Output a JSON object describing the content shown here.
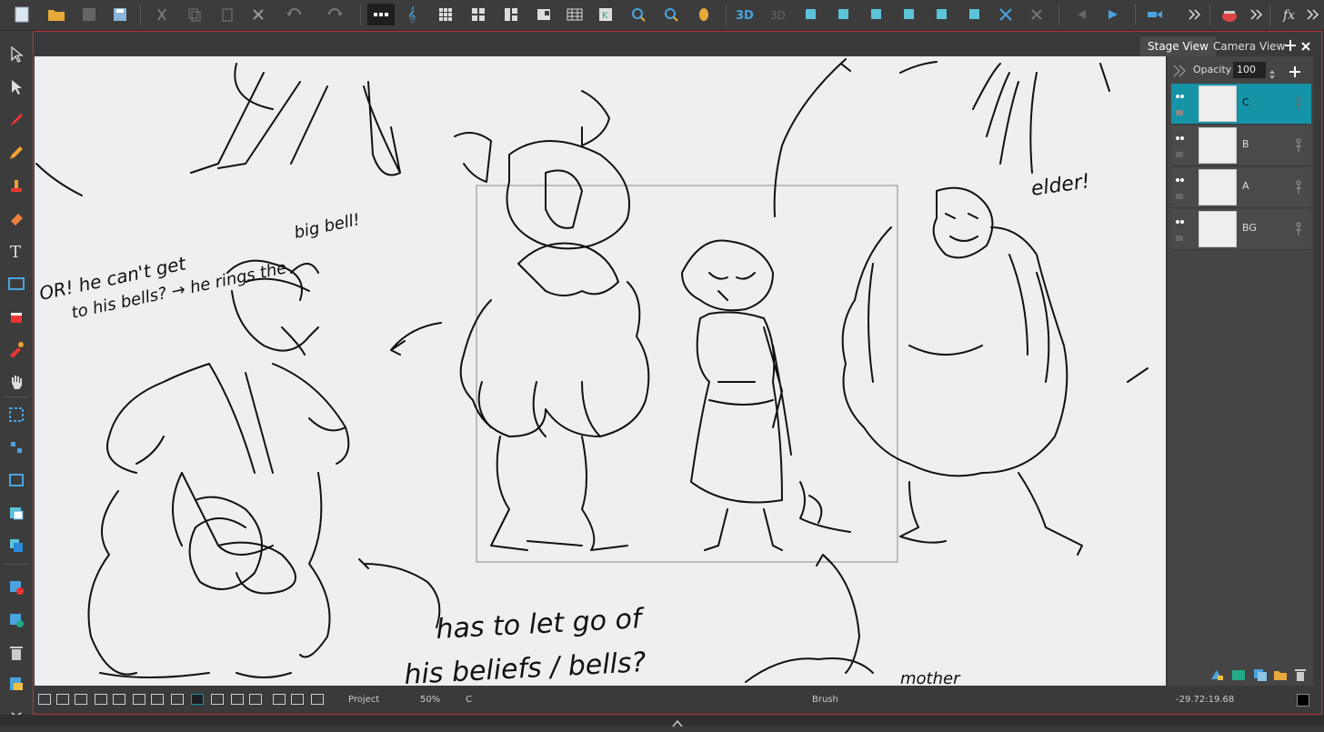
{
  "tabs": {
    "stage_view": "Stage View",
    "camera_view": "Camera View"
  },
  "layers_panel": {
    "opacity_label": "Opacity",
    "opacity_value": "100",
    "layers": [
      {
        "name": "C",
        "selected": true
      },
      {
        "name": "B",
        "selected": false
      },
      {
        "name": "A",
        "selected": false
      },
      {
        "name": "BG",
        "selected": false
      }
    ]
  },
  "status_bar": {
    "mode": "Project",
    "zoom": "50%",
    "layer": "C",
    "tool": "Brush",
    "coordinates": "-29.72:19.68"
  },
  "colors": {
    "accent": "#1594a8",
    "frame_border": "#b33333",
    "canvas": "#efefef"
  },
  "canvas_text": {
    "note_left_1": "OR! he can't get",
    "note_left_2": "to his bells? → he rings the",
    "note_left_3": "big bell!",
    "note_elder": "elder!",
    "note_bottom_1": "has to let go of",
    "note_bottom_2": "his beliefs / bells?",
    "note_bottom_3": "mother"
  }
}
